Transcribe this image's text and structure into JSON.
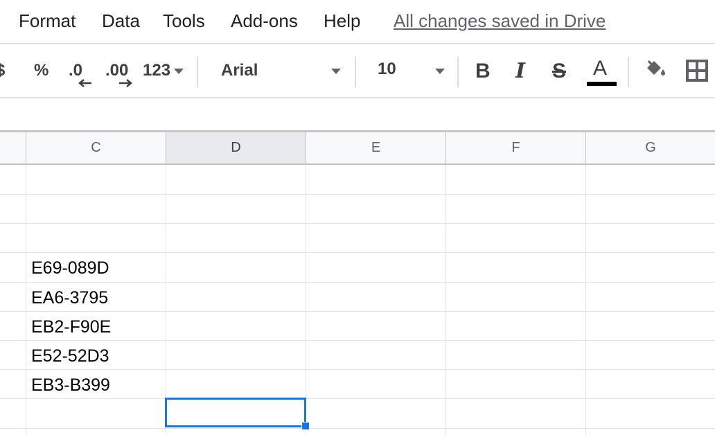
{
  "menu": {
    "items": [
      "Format",
      "Data",
      "Tools",
      "Add-ons",
      "Help"
    ],
    "saved_status": "All changes saved in Drive"
  },
  "toolbar": {
    "currency": "$",
    "percent": "%",
    "decrease_decimal": ".0",
    "increase_decimal": ".00",
    "more_formats": "123",
    "font_family": "Arial",
    "font_size": "10",
    "bold_icon": "B",
    "italic_icon": "I",
    "strikethrough_icon": "S",
    "text_color_icon": "A",
    "text_color": "#000000"
  },
  "grid": {
    "columns": [
      "C",
      "D",
      "E",
      "F",
      "G"
    ],
    "selected_column": "D",
    "column_c_values": [
      "",
      "",
      "",
      "E69-089D",
      "EA6-3795",
      "EB2-F90E",
      "E52-52D3",
      "EB3-B399",
      ""
    ]
  },
  "colors": {
    "accent": "#1a73e8",
    "header_bg": "#f8f9fa"
  }
}
